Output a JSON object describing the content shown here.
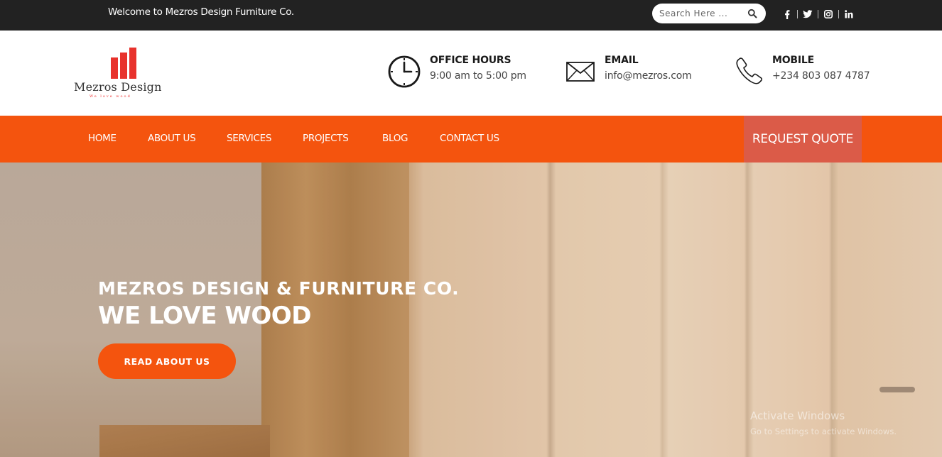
{
  "topbar": {
    "welcome": "Welcome to Mezros Design Furniture Co.",
    "search_placeholder": "Search Here ...",
    "social": [
      "facebook-icon",
      "twitter-icon",
      "instagram-icon",
      "linkedin-icon"
    ]
  },
  "header": {
    "logo_text": "Mezros Design",
    "logo_tagline": "We love wood",
    "office_hours": {
      "title": "OFFICE HOURS",
      "value": "9:00 am to 5:00 pm",
      "icon": "clock-icon"
    },
    "email": {
      "title": "EMAIL",
      "value": "info@mezros.com",
      "icon": "envelope-icon"
    },
    "mobile": {
      "title": "MOBILE",
      "value": "+234 803 087 4787",
      "icon": "phone-icon"
    }
  },
  "nav": {
    "items": [
      "HOME",
      "ABOUT US",
      "SERVICES",
      "PROJECTS",
      "BLOG",
      "CONTACT US"
    ],
    "quote_label": "REQUEST QUOTE"
  },
  "hero": {
    "subtitle": "MEZROS DESIGN & FURNITURE CO.",
    "title": "WE LOVE WOOD",
    "button_label": "READ ABOUT US"
  },
  "watermark": {
    "title": "Activate Windows",
    "subtitle": "Go to Settings to activate Windows."
  },
  "colors": {
    "accent": "#f4540e",
    "quote_bg": "#db5b48",
    "topbar_bg": "#222222",
    "logo_red": "#e8322c"
  }
}
